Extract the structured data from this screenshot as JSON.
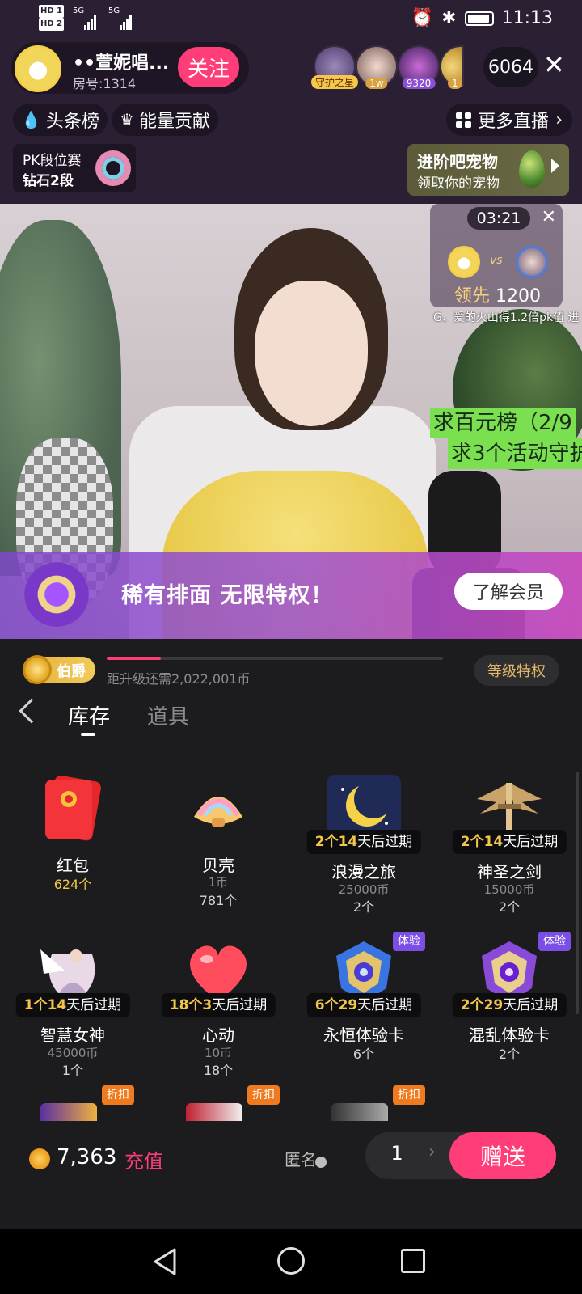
{
  "status_bar": {
    "left_hd1": "HD 1",
    "left_hd2": "HD 2",
    "net1": "5G",
    "net2": "5G",
    "time": "11:13"
  },
  "host": {
    "name": "••萱妮唱...",
    "room": "房号:1314",
    "follow_label": "关注"
  },
  "viewers": [
    {
      "badge": "守护之星",
      "color": "#f5c74a"
    },
    {
      "badge": "1w",
      "color": "#d9a13f"
    },
    {
      "badge": "9320",
      "color": "#8b4fd1"
    },
    {
      "badge": "1",
      "color": "#d9a13f"
    }
  ],
  "viewer_count": "6064",
  "close_icon": "✕",
  "chips": {
    "headline": "头条榜",
    "energy": "能量贡献",
    "more_live": "更多直播"
  },
  "pk_rank": {
    "title": "PK段位赛",
    "level": "钻石2段"
  },
  "pet_promo": {
    "title": "进阶吧宠物",
    "subtitle": "领取你的宠物"
  },
  "pk_box": {
    "timer": "03:21",
    "vs": "vs",
    "lead_label": "领先",
    "lead_value": "1200",
    "ticker": "G、爱的火山得1.2倍pk值  进"
  },
  "overlay_text": {
    "line1": "求百元榜（2/9",
    "line2": "求3个活动守护"
  },
  "member_banner": {
    "text": "稀有排面  无限特权！",
    "button": "了解会员"
  },
  "level": {
    "badge": "伯爵",
    "progress": 0.16,
    "hint": "距升级还需2,022,001币",
    "privilege_button": "等级特权"
  },
  "tabs": [
    {
      "label": "库存",
      "active": true
    },
    {
      "label": "道具",
      "active": false
    }
  ],
  "gifts": [
    {
      "name": "红包",
      "price": "",
      "qty": "624个",
      "exp_count": "",
      "exp_text": "",
      "tag": "",
      "icon": "red-packet-icon"
    },
    {
      "name": "贝壳",
      "price": "1币",
      "qty": "781个",
      "exp_count": "",
      "exp_text": "",
      "tag": "",
      "icon": "seashell-icon"
    },
    {
      "name": "浪漫之旅",
      "price": "25000币",
      "qty": "2个",
      "exp_count": "2个14",
      "exp_text": "天后过期",
      "tag": "",
      "icon": "moon-icon"
    },
    {
      "name": "神圣之剑",
      "price": "15000币",
      "qty": "2个",
      "exp_count": "2个14",
      "exp_text": "天后过期",
      "tag": "",
      "icon": "winged-sword-icon"
    },
    {
      "name": "智慧女神",
      "price": "45000币",
      "qty": "1个",
      "exp_count": "1个14",
      "exp_text": "天后过期",
      "tag": "",
      "icon": "goddess-icon"
    },
    {
      "name": "心动",
      "price": "10币",
      "qty": "18个",
      "exp_count": "18个3",
      "exp_text": "天后过期",
      "tag": "",
      "icon": "heart-icon"
    },
    {
      "name": "永恒体验卡",
      "price": "",
      "qty": "6个",
      "exp_count": "6个29",
      "exp_text": "天后过期",
      "tag": "体验",
      "icon": "eternal-badge-icon"
    },
    {
      "name": "混乱体验卡",
      "price": "",
      "qty": "2个",
      "exp_count": "2个29",
      "exp_text": "天后过期",
      "tag": "体验",
      "icon": "chaos-badge-icon"
    }
  ],
  "discount_tag": "折扣",
  "bottom": {
    "balance": "7,363",
    "recharge": "充值",
    "anonymous": "匿名",
    "quantity": "1",
    "send": "赠送"
  }
}
